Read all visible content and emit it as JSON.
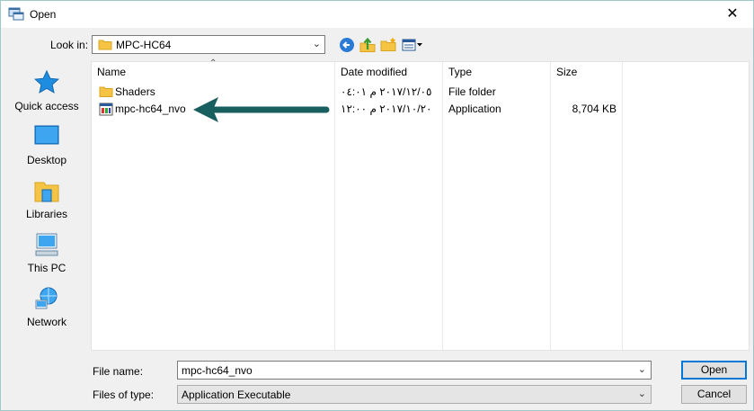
{
  "titlebar": {
    "title": "Open",
    "close_glyph": "✕"
  },
  "toolbar": {
    "look_in_label": "Look in:",
    "look_in_value": "MPC-HC64",
    "buttons": [
      "back-icon",
      "up-folder-icon",
      "new-folder-icon",
      "view-menu-icon"
    ]
  },
  "places": [
    {
      "label": "Quick access",
      "icon": "star-icon"
    },
    {
      "label": "Desktop",
      "icon": "desktop-icon"
    },
    {
      "label": "Libraries",
      "icon": "libraries-icon"
    },
    {
      "label": "This PC",
      "icon": "computer-icon"
    },
    {
      "label": "Network",
      "icon": "network-icon"
    }
  ],
  "columns": {
    "name": "Name",
    "date": "Date modified",
    "type": "Type",
    "size": "Size"
  },
  "files": [
    {
      "name": "Shaders",
      "date": "٢٠١٧/١٢/٠٥ م ٠٤:٠١",
      "type": "File folder",
      "size": "",
      "icon": "folder-icon"
    },
    {
      "name": "mpc-hc64_nvo",
      "date": "٢٠١٧/١٠/٢٠ م ١٢:٠٠",
      "type": "Application",
      "size": "8,704 KB",
      "icon": "application-icon"
    }
  ],
  "bottom": {
    "file_name_label": "File name:",
    "file_name_value": "mpc-hc64_nvo",
    "files_of_type_label": "Files of type:",
    "files_of_type_value": "Application Executable",
    "open_label": "Open",
    "cancel_label": "Cancel"
  },
  "colors": {
    "accent": "#0078d7",
    "arrow": "#1a5f5f",
    "folder": "#f6c444"
  }
}
